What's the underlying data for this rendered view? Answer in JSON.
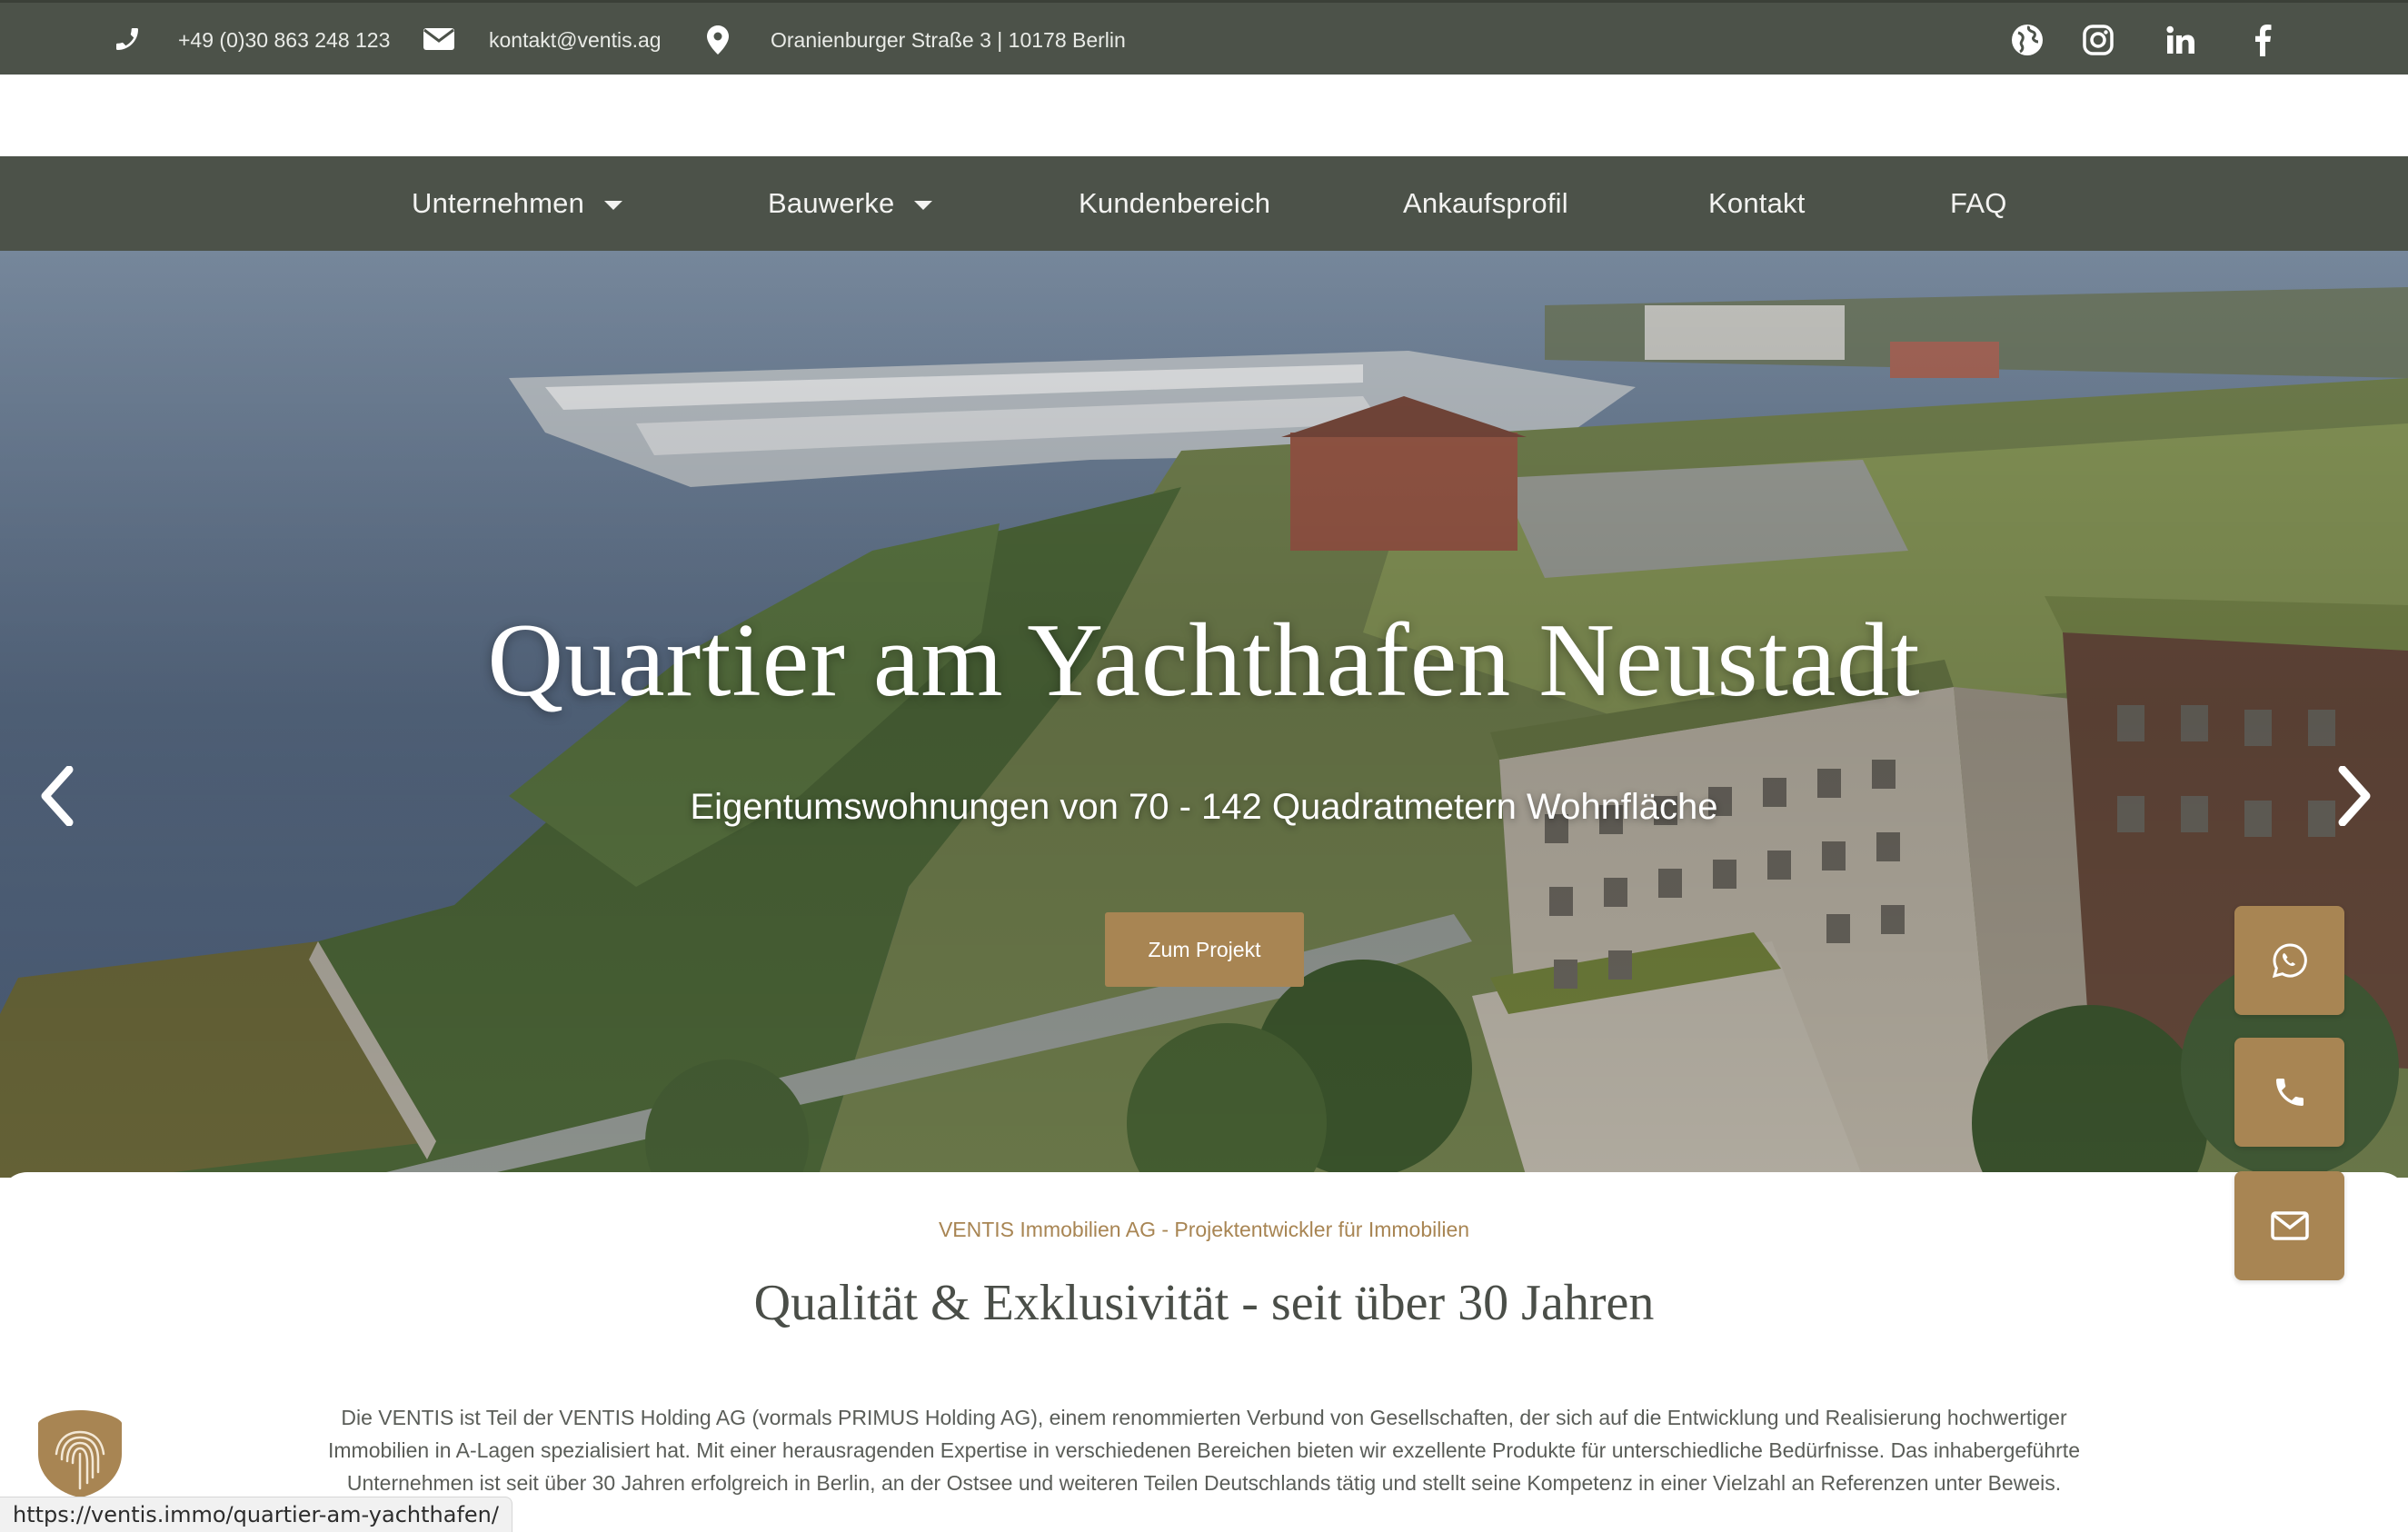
{
  "topbar": {
    "phone": "+49 (0)30 863 248 123",
    "email": "kontakt@ventis.ag",
    "address": "Oranienburger Straße 3 | 10178 Berlin",
    "social_icons": [
      "globe-icon",
      "instagram-icon",
      "linkedin-icon",
      "facebook-icon"
    ]
  },
  "nav": {
    "items": [
      {
        "label": "Unternehmen",
        "has_dropdown": true
      },
      {
        "label": "Bauwerke",
        "has_dropdown": true
      },
      {
        "label": "Kundenbereich",
        "has_dropdown": false
      },
      {
        "label": "Ankaufsprofil",
        "has_dropdown": false
      },
      {
        "label": "Kontakt",
        "has_dropdown": false
      },
      {
        "label": "FAQ",
        "has_dropdown": false
      }
    ]
  },
  "hero": {
    "title": "Quartier am Yachthafen Neustadt",
    "subtitle": "Eigentumswohnungen von 70 - 142 Quadratmetern Wohnfläche",
    "cta_label": "Zum Projekt"
  },
  "floating_buttons": [
    "whatsapp-icon",
    "phone-icon",
    "mail-icon"
  ],
  "intro": {
    "eyebrow": "VENTIS Immobilien AG - Projektentwickler für Immobilien",
    "heading": "Qualität & Exklusivität - seit über 30 Jahren",
    "body": "Die VENTIS ist Teil der VENTIS Holding AG (vormals PRIMUS Holding AG), einem renommierten Verbund von Gesellschaften, der sich auf die Entwicklung und Realisierung hochwertiger Immobilien in A-Lagen spezialisiert hat. Mit einer herausragenden Expertise in verschiedenen Bereichen bieten wir exzellente Produkte für unterschiedliche Bedürfnisse. Das inhabergeführte Unternehmen ist seit über 30 Jahren erfolgreich in Berlin, an der Ostsee und weiteren Teilen Deutschlands tätig und stellt seine Kompetenz in einer Vielzahl an Referenzen unter Beweis."
  },
  "status_bar": {
    "url": "https://ventis.immo/quartier-am-yachthafen/"
  },
  "colors": {
    "bar": "#4c5249",
    "accent": "#a88553"
  }
}
